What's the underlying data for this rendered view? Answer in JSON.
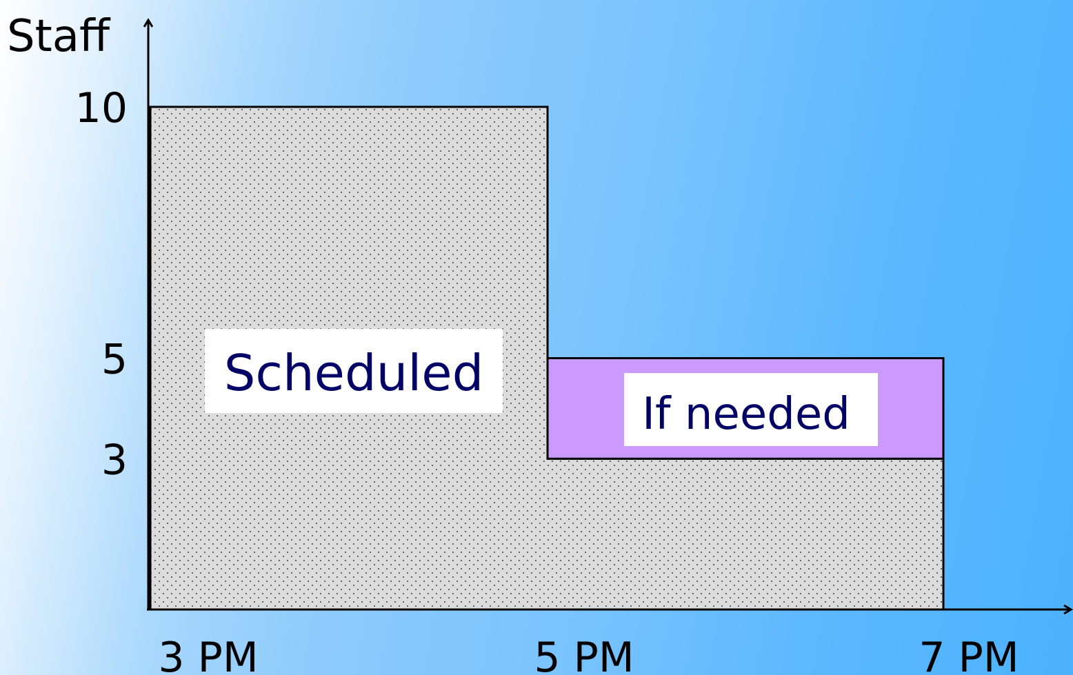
{
  "chart_data": {
    "type": "area",
    "ylabel": "Staff",
    "yticks": [
      10,
      5,
      3
    ],
    "xticks": [
      "3 PM",
      "5 PM",
      "7 PM"
    ],
    "series": [
      {
        "name": "Scheduled",
        "segments": [
          {
            "x_start": "3 PM",
            "x_end": "5 PM",
            "value": 10
          },
          {
            "x_start": "5 PM",
            "x_end": "7 PM",
            "value": 3
          }
        ],
        "color": "#dcdcdc",
        "pattern": "dotted"
      },
      {
        "name": "If needed",
        "segments": [
          {
            "x_start": "5 PM",
            "x_end": "7 PM",
            "from": 3,
            "to": 5
          }
        ],
        "color": "#cc99ff"
      }
    ],
    "label_text_color": "#000066",
    "label_box_color": "#ffffff"
  }
}
